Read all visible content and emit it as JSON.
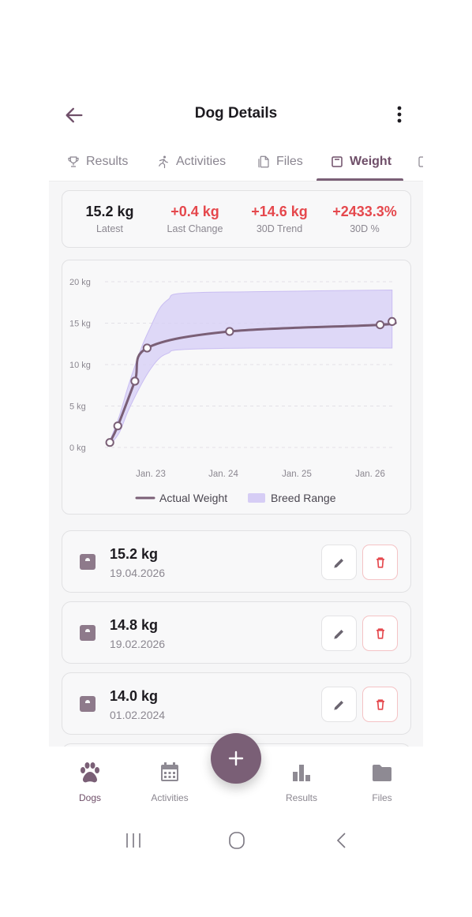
{
  "header": {
    "title": "Dog Details"
  },
  "tabs": [
    {
      "label": "Results",
      "icon": "trophy-icon"
    },
    {
      "label": "Activities",
      "icon": "running-icon"
    },
    {
      "label": "Files",
      "icon": "file-icon"
    },
    {
      "label": "Weight",
      "icon": "scale-icon",
      "active": true
    }
  ],
  "stats": [
    {
      "value": "15.2 kg",
      "label": "Latest",
      "tone": "neutral"
    },
    {
      "value": "+0.4 kg",
      "label": "Last Change",
      "tone": "red"
    },
    {
      "value": "+14.6 kg",
      "label": "30D Trend",
      "tone": "red"
    },
    {
      "value": "+2433.3%",
      "label": "30D %",
      "tone": "red"
    }
  ],
  "chart_data": {
    "type": "line",
    "y_ticks": [
      "20 kg",
      "15 kg",
      "10 kg",
      "5 kg",
      "0 kg"
    ],
    "x_ticks": [
      "Jan. 23",
      "Jan. 24",
      "Jan. 25",
      "Jan. 26"
    ],
    "ylim": [
      0,
      20
    ],
    "grid": true,
    "legend_position": "bottom",
    "series": [
      {
        "name": "Actual Weight",
        "color": "#7a5f76",
        "points": [
          {
            "x": "2022-08-20",
            "y": 0.6
          },
          {
            "x": "2022-09-15",
            "y": 2.6
          },
          {
            "x": "2022-11-10",
            "y": 8.0
          },
          {
            "x": "2022-12-20",
            "y": 12.0
          },
          {
            "x": "2024-02-01",
            "y": 14.0
          },
          {
            "x": "2026-02-19",
            "y": 14.8
          },
          {
            "x": "2026-04-19",
            "y": 15.2
          }
        ]
      },
      {
        "name": "Breed Range",
        "color": "#d6cdf5",
        "type": "band",
        "upper": [
          {
            "x": "2022-08-20",
            "y": 0.8
          },
          {
            "x": "2022-09-20",
            "y": 3.8
          },
          {
            "x": "2022-10-20",
            "y": 7.5
          },
          {
            "x": "2022-12-01",
            "y": 12.0
          },
          {
            "x": "2023-01-01",
            "y": 14.6
          },
          {
            "x": "2023-02-15",
            "y": 16.8
          },
          {
            "x": "2023-04-01",
            "y": 17.9
          },
          {
            "x": "2023-06-01",
            "y": 18.6
          },
          {
            "x": "2024-06-01",
            "y": 18.8
          },
          {
            "x": "2026-04-19",
            "y": 19.0
          }
        ],
        "lower": [
          {
            "x": "2022-08-20",
            "y": 0.3
          },
          {
            "x": "2022-09-20",
            "y": 1.8
          },
          {
            "x": "2022-10-20",
            "y": 4.5
          },
          {
            "x": "2022-12-01",
            "y": 7.6
          },
          {
            "x": "2023-01-01",
            "y": 9.5
          },
          {
            "x": "2023-02-15",
            "y": 10.8
          },
          {
            "x": "2023-04-01",
            "y": 11.4
          },
          {
            "x": "2023-06-01",
            "y": 11.8
          },
          {
            "x": "2024-06-01",
            "y": 12.0
          },
          {
            "x": "2026-04-19",
            "y": 12.0
          }
        ]
      }
    ],
    "legend": [
      {
        "label": "Actual Weight",
        "color": "#7a5f76",
        "kind": "line"
      },
      {
        "label": "Breed Range",
        "color": "#d6cdf5",
        "kind": "band"
      }
    ]
  },
  "entries": [
    {
      "weight": "15.2 kg",
      "date": "19.04.2026"
    },
    {
      "weight": "14.8 kg",
      "date": "19.02.2026"
    },
    {
      "weight": "14.0 kg",
      "date": "01.02.2024"
    }
  ],
  "bottom_nav": [
    {
      "label": "Dogs",
      "icon": "paw-icon",
      "active": true
    },
    {
      "label": "Activities",
      "icon": "calendar-icon"
    },
    {
      "label": "Results",
      "icon": "bar-chart-icon"
    },
    {
      "label": "Files",
      "icon": "folder-icon"
    }
  ],
  "fab": {
    "icon": "plus-icon"
  },
  "colors": {
    "primary": "#7a5f76",
    "danger": "#e5484d",
    "band": "#d6cdf5"
  }
}
